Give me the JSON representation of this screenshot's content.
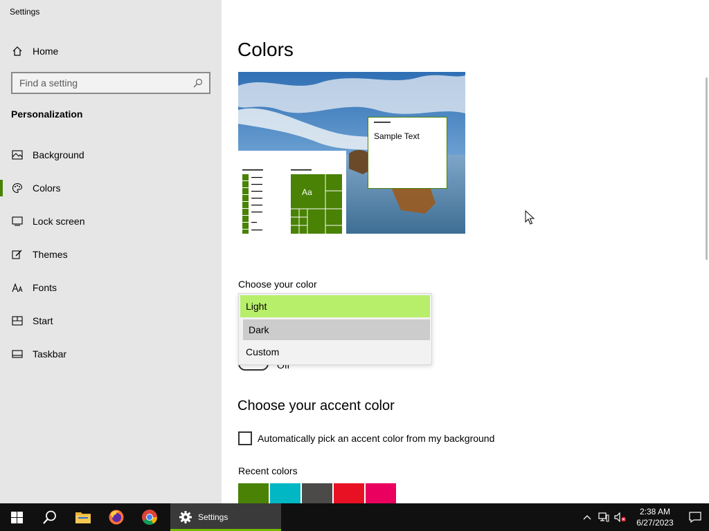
{
  "window": {
    "title": "Settings"
  },
  "sidebar": {
    "home_label": "Home",
    "search_placeholder": "Find a setting",
    "section_title": "Personalization",
    "items": [
      {
        "label": "Background",
        "icon": "image-icon"
      },
      {
        "label": "Colors",
        "icon": "palette-icon",
        "active": true
      },
      {
        "label": "Lock screen",
        "icon": "lock-screen-icon"
      },
      {
        "label": "Themes",
        "icon": "brush-icon"
      },
      {
        "label": "Fonts",
        "icon": "fonts-icon"
      },
      {
        "label": "Start",
        "icon": "start-icon"
      },
      {
        "label": "Taskbar",
        "icon": "taskbar-icon"
      }
    ]
  },
  "main": {
    "page_title": "Colors",
    "preview_sample_text": "Sample Text",
    "preview_tile_label": "Aa",
    "choose_color_label": "Choose your color",
    "color_options": [
      "Light",
      "Dark",
      "Custom"
    ],
    "selected_option": "Light",
    "toggle_state_label": "Off",
    "accent_title": "Choose your accent color",
    "auto_pick_label": "Automatically pick an accent color from my background",
    "auto_pick_checked": false,
    "recent_colors_label": "Recent colors",
    "recent_colors": [
      "#498205",
      "#00b7c3",
      "#4c4a48",
      "#e81123",
      "#ea005e"
    ]
  },
  "taskbar": {
    "app_label": "Settings",
    "time": "2:38 AM",
    "date": "6/27/2023"
  },
  "colors": {
    "accent": "#498205",
    "highlight": "#b7ef6a",
    "taskbar": "#101010"
  }
}
